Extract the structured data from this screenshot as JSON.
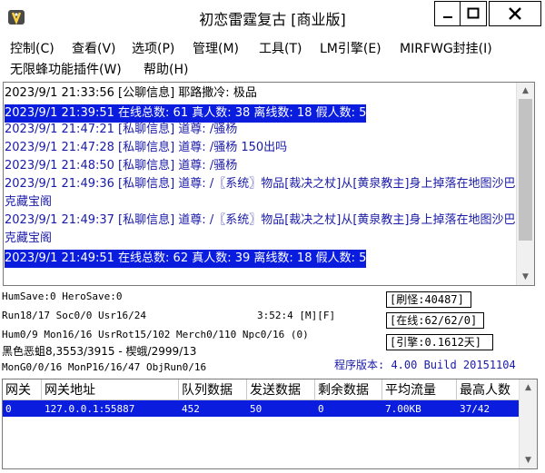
{
  "window": {
    "title": "初恋雷霆复古 [商业版]"
  },
  "menu": [
    "控制(C)",
    "查看(V)",
    "选项(P)",
    "管理(M)",
    "工具(T)",
    "LM引擎(E)",
    "MIRFWG封挂(I)",
    "无限蜂功能插件(W)",
    "帮助(H)"
  ],
  "log": [
    {
      "text": "2023/9/1 21:33:56 [公聊信息] 耶路撒冷: 极品",
      "style": "black"
    },
    {
      "text": "2023/9/1 21:39:51 在线总数: 61 真人数: 38 离线数: 18 假人数: 5",
      "style": "sel"
    },
    {
      "text": "2023/9/1 21:47:21 [私聊信息] 道尊: /骚杨",
      "style": "blue"
    },
    {
      "text": "2023/9/1 21:47:28 [私聊信息] 道尊: /骚杨 150出吗",
      "style": "blue"
    },
    {
      "text": "2023/9/1 21:48:50 [私聊信息] 道尊: /骚杨",
      "style": "blue"
    },
    {
      "text": "2023/9/1 21:49:36 [私聊信息] 道尊: /〖系统〗物品[裁决之杖]从[黄泉教主]身上掉落在地图沙巴克藏宝阁",
      "style": "wrap"
    },
    {
      "text": "2023/9/1 21:49:37 [私聊信息] 道尊: /〖系统〗物品[裁决之杖]从[黄泉教主]身上掉落在地图沙巴克藏宝阁",
      "style": "wrap"
    },
    {
      "text": "2023/9/1 21:49:51 在线总数: 62 真人数: 39 离线数: 18 假人数: 5",
      "style": "sel"
    }
  ],
  "stats": {
    "line1": "HumSave:0 HeroSave:0",
    "line2": "Run18/17 Soc0/0 Usr16/24",
    "time": "3:52:4 [M][F]",
    "line3": "Hum0/9 Mon16/16 UsrRot15/102 Merch0/110 Npc0/16 (0)",
    "line4": "黑色恶蛆8,3553/3915 - 楔蛾/2999/13",
    "line5": "MonG0/0/16 MonP16/16/47 ObjRun0/16",
    "refresh": "[刷怪:40487]",
    "online": "[在线:62/62/0]",
    "engine": "[引擎:0.1612天]",
    "version": "程序版本: 4.00 Build 20151104"
  },
  "table": {
    "headers": [
      "网关",
      "网关地址",
      "队列数据",
      "发送数据",
      "剩余数据",
      "平均流量",
      "最高人数"
    ],
    "rows": [
      [
        "0",
        "127.0.0.1:55887",
        "452",
        "50",
        "0",
        "7.00KB",
        "37/42"
      ]
    ]
  },
  "colors": {
    "selection": "#0a1ddf",
    "log_blue": "#1a1aa8"
  }
}
